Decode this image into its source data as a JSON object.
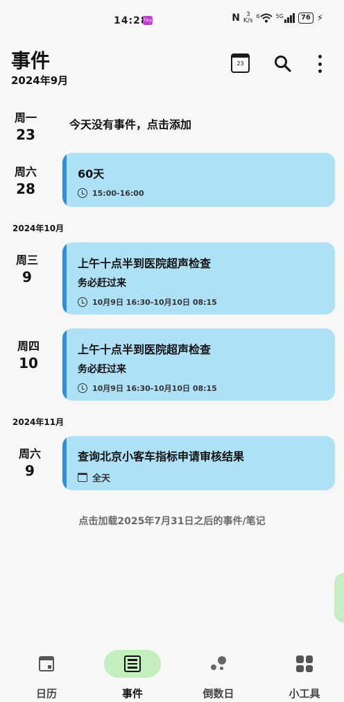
{
  "status": {
    "time": "14:28",
    "app_badge": "Tiny",
    "nfc": "N",
    "speed_value": "3",
    "speed_unit": "K/s",
    "wifi_label": "6",
    "network": "5G",
    "battery": "76"
  },
  "header": {
    "title": "事件",
    "subtitle": "2024年9月",
    "calendar_day": "23"
  },
  "days": [
    {
      "weekday": "周一",
      "date": "23"
    },
    {
      "weekday": "周六",
      "date": "28"
    },
    {
      "weekday": "周三",
      "date": "9"
    },
    {
      "weekday": "周四",
      "date": "10"
    },
    {
      "weekday": "周六",
      "date": "9"
    }
  ],
  "empty_text": "今天没有事件，点击添加",
  "months": [
    "2024年10月",
    "2024年11月"
  ],
  "events": [
    {
      "title": "60天",
      "time": "15:00-16:00"
    },
    {
      "title": "上午十点半到医院超声检查",
      "desc": "务必赶过来",
      "time": "10月9日 16:30-10月10日 08:15"
    },
    {
      "title": "上午十点半到医院超声检查",
      "desc": "务必赶过来",
      "time": "10月9日 16:30-10月10日 08:15"
    },
    {
      "title": "查询北京小客车指标申请审核结果",
      "time": "全天"
    }
  ],
  "load_more": "点击加载2025年7月31日之后的事件/笔记",
  "nav": [
    {
      "label": "日历",
      "icon": "calendar-icon"
    },
    {
      "label": "事件",
      "icon": "list-icon",
      "active": true
    },
    {
      "label": "倒数日",
      "icon": "dots-icon"
    },
    {
      "label": "小工具",
      "icon": "grid-icon"
    }
  ],
  "colors": {
    "card_bg": "#aee0f6",
    "card_accent": "#2e8fe0",
    "nav_active": "#c4eebf"
  }
}
